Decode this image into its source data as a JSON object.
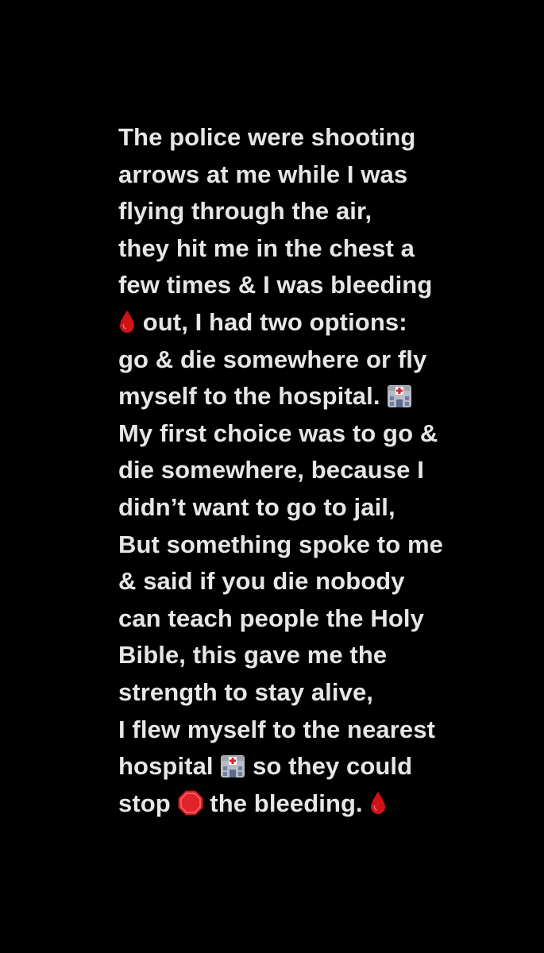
{
  "story": {
    "lines": [
      "The police were shooting",
      "arrows at me while I was",
      "flying through the air,",
      "they hit me in the chest a",
      "few times & I was bleeding",
      " out, I had two options:",
      "go & die somewhere or fly",
      "myself to the hospital. ",
      "My first choice was to go &",
      "die somewhere, because I",
      "didn’t want to go to jail,",
      "But something spoke to me",
      "& said if you die nobody",
      "can teach people the Holy",
      "Bible, this gave me the",
      "strength to stay alive,",
      "I flew myself to the nearest",
      "hospital ",
      " so they could",
      "stop ",
      " the bleeding. "
    ]
  },
  "emojis": {
    "drop": "drop-of-blood-icon",
    "hospital": "hospital-icon",
    "stop": "stop-sign-icon"
  },
  "colors": {
    "background": "#000000",
    "text": "#e6e6e6",
    "blood": "#d0121b",
    "stop": "#e0242a"
  }
}
